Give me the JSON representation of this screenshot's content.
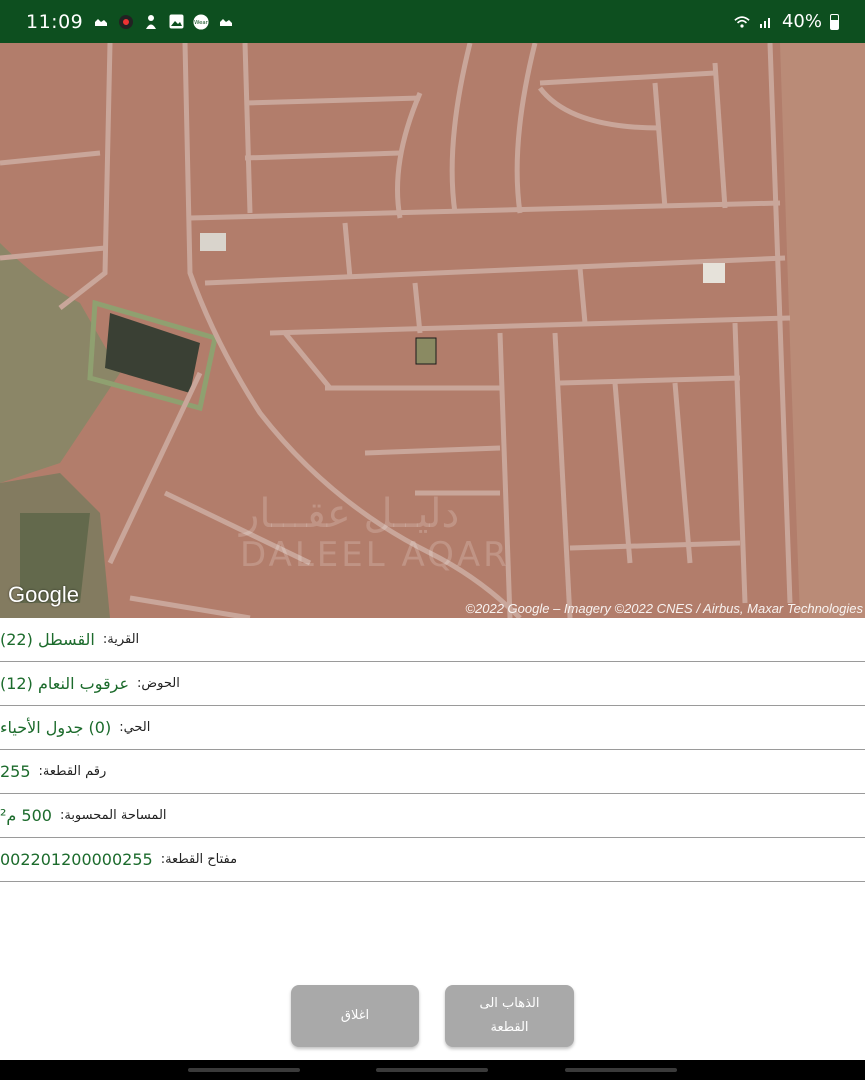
{
  "status_bar": {
    "time": "11:09",
    "battery": "40%",
    "icons": [
      "notification-icon",
      "app-icon",
      "app-icon",
      "gallery-icon",
      "wear-icon",
      "notification-icon"
    ],
    "wear_label": "Wear"
  },
  "map": {
    "google_logo": "Google",
    "attribution": "©2022 Google – Imagery ©2022 CNES / Airbus, Maxar Technologies",
    "watermark_ar": "دليــل عقـــار",
    "watermark_en": "DALEEL AQAR"
  },
  "parcel_info": [
    {
      "label": "القرية:",
      "value": "القسطل (22)"
    },
    {
      "label": "الحوض:",
      "value": "عرقوب النعام (12)"
    },
    {
      "label": "الحي:",
      "value": "(0) جدول الأحياء"
    },
    {
      "label": "رقم القطعة:",
      "value": "255"
    },
    {
      "label": "المساحة المحسوبة:",
      "value": "500 م²"
    },
    {
      "label": "مفتاح القطعة:",
      "value": "002201200000255"
    }
  ],
  "buttons": {
    "close_label": "اغلاق",
    "go_label_line1": "الذهاب الى",
    "go_label_line2": "القطعة"
  },
  "colors": {
    "status_bar": "#0d4f1f",
    "value_text": "#1c6b2c",
    "button": "#a9a9a9"
  }
}
